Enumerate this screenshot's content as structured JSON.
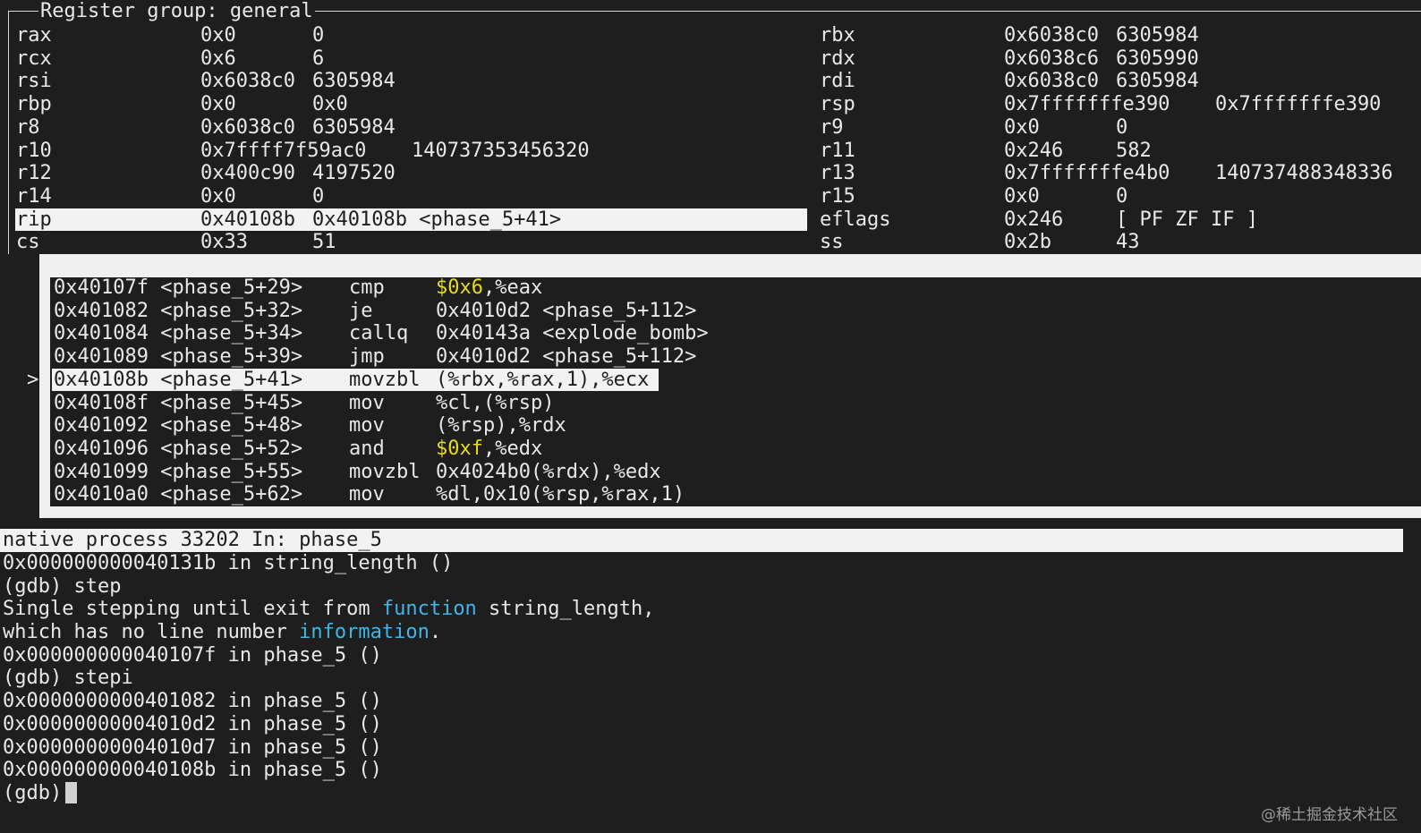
{
  "register_panel": {
    "title": "Register group: general",
    "rows": [
      {
        "left": {
          "name": "rax",
          "hex": "0x0",
          "val": "0"
        },
        "right": {
          "name": "rbx",
          "hex": "0x6038c0",
          "val": "6305984"
        }
      },
      {
        "left": {
          "name": "rcx",
          "hex": "0x6",
          "val": "6"
        },
        "right": {
          "name": "rdx",
          "hex": "0x6038c6",
          "val": "6305990"
        }
      },
      {
        "left": {
          "name": "rsi",
          "hex": "0x6038c0",
          "val": "6305984"
        },
        "right": {
          "name": "rdi",
          "hex": "0x6038c0",
          "val": "6305984"
        }
      },
      {
        "left": {
          "name": "rbp",
          "hex": "0x0",
          "val": "0x0"
        },
        "right": {
          "name": "rsp",
          "hex": "0x7fffffffe390",
          "val": "0x7fffffffe390"
        }
      },
      {
        "left": {
          "name": "r8",
          "hex": "0x6038c0",
          "val": "6305984"
        },
        "right": {
          "name": "r9",
          "hex": "0x0",
          "val": "0"
        }
      },
      {
        "left": {
          "name": "r10",
          "hex": "0x7ffff7f59ac0",
          "val": "140737353456320"
        },
        "right": {
          "name": "r11",
          "hex": "0x246",
          "val": "582"
        }
      },
      {
        "left": {
          "name": "r12",
          "hex": "0x400c90",
          "val": "4197520"
        },
        "right": {
          "name": "r13",
          "hex": "0x7fffffffe4b0",
          "val": "140737488348336"
        }
      },
      {
        "left": {
          "name": "r14",
          "hex": "0x0",
          "val": "0"
        },
        "right": {
          "name": "r15",
          "hex": "0x0",
          "val": "0"
        }
      },
      {
        "left": {
          "name": "rip",
          "hex": "0x40108b",
          "val": "0x40108b <phase_5+41>"
        },
        "right": {
          "name": "eflags",
          "hex": "0x246",
          "val": "[ PF ZF IF ]"
        },
        "highlight": true
      },
      {
        "left": {
          "name": "cs",
          "hex": "0x33",
          "val": "51"
        },
        "right": {
          "name": "ss",
          "hex": "0x2b",
          "val": "43"
        }
      }
    ]
  },
  "asm_panel": {
    "current_marker": ">",
    "rows": [
      {
        "addr": "0x40107f <phase_5+29>",
        "op": "cmp",
        "imm": "$0x6",
        "rest": ",%eax"
      },
      {
        "addr": "0x401082 <phase_5+32>",
        "op": "je",
        "imm": "",
        "rest": "0x4010d2 <phase_5+112>"
      },
      {
        "addr": "0x401084 <phase_5+34>",
        "op": "callq",
        "imm": "",
        "rest": "0x40143a <explode_bomb>"
      },
      {
        "addr": "0x401089 <phase_5+39>",
        "op": "jmp",
        "imm": "",
        "rest": "0x4010d2 <phase_5+112>"
      },
      {
        "addr": "0x40108b <phase_5+41>",
        "op": "movzbl",
        "imm": "",
        "rest": "(%rbx,%rax,1),%ecx",
        "highlight": true
      },
      {
        "addr": "0x40108f <phase_5+45>",
        "op": "mov",
        "imm": "",
        "rest": "%cl,(%rsp)"
      },
      {
        "addr": "0x401092 <phase_5+48>",
        "op": "mov",
        "imm": "",
        "rest": "(%rsp),%rdx"
      },
      {
        "addr": "0x401096 <phase_5+52>",
        "op": "and",
        "imm": "$0xf",
        "rest": ",%edx"
      },
      {
        "addr": "0x401099 <phase_5+55>",
        "op": "movzbl",
        "imm": "",
        "rest": "0x4024b0(%rdx),%edx"
      },
      {
        "addr": "0x4010a0 <phase_5+62>",
        "op": "mov",
        "imm": "",
        "rest": "%dl,0x10(%rsp,%rax,1)"
      }
    ]
  },
  "status_bar": {
    "text": "native process 33202 In: phase_5"
  },
  "console": {
    "lines": [
      {
        "pre": "0x000000000040131b in string_length ()",
        "kw": "",
        "post": ""
      },
      {
        "pre": "(gdb) step",
        "kw": "",
        "post": ""
      },
      {
        "pre": "Single stepping until exit from ",
        "kw": "function",
        "post": " string_length,"
      },
      {
        "pre": "which has no line number ",
        "kw": "information",
        "post": "."
      },
      {
        "pre": "0x000000000040107f in phase_5 ()",
        "kw": "",
        "post": ""
      },
      {
        "pre": "(gdb) stepi",
        "kw": "",
        "post": ""
      },
      {
        "pre": "0x0000000000401082 in phase_5 ()",
        "kw": "",
        "post": ""
      },
      {
        "pre": "0x00000000004010d2 in phase_5 ()",
        "kw": "",
        "post": ""
      },
      {
        "pre": "0x00000000004010d7 in phase_5 ()",
        "kw": "",
        "post": ""
      },
      {
        "pre": "0x000000000040108b in phase_5 ()",
        "kw": "",
        "post": ""
      }
    ],
    "prompt": "(gdb)"
  },
  "watermark": "@稀土掘金技术社区"
}
